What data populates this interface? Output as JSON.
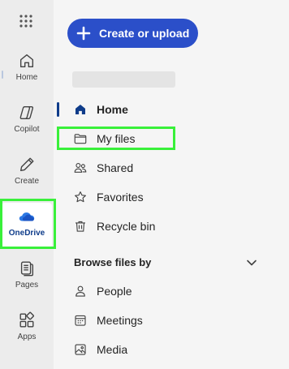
{
  "rail": {
    "items": [
      {
        "label": "Home",
        "icon": "home-icon"
      },
      {
        "label": "Copilot",
        "icon": "copilot-icon"
      },
      {
        "label": "Create",
        "icon": "pen-icon"
      },
      {
        "label": "OneDrive",
        "icon": "onedrive-cloud-icon"
      },
      {
        "label": "Pages",
        "icon": "pages-icon"
      },
      {
        "label": "Apps",
        "icon": "apps-icon"
      }
    ]
  },
  "create_button": {
    "label": "Create or upload"
  },
  "nav": {
    "items": [
      {
        "label": "Home",
        "icon": "home-icon"
      },
      {
        "label": "My files",
        "icon": "folder-icon"
      },
      {
        "label": "Shared",
        "icon": "people-icon"
      },
      {
        "label": "Favorites",
        "icon": "star-icon"
      },
      {
        "label": "Recycle bin",
        "icon": "trash-icon"
      }
    ]
  },
  "browse": {
    "heading": "Browse files by",
    "items": [
      {
        "label": "People",
        "icon": "person-icon"
      },
      {
        "label": "Meetings",
        "icon": "calendar-icon"
      },
      {
        "label": "Media",
        "icon": "image-icon"
      }
    ]
  },
  "colors": {
    "accent": "#2b4fc9",
    "highlight": "#39f03a",
    "onedrive": "#0f3c8a"
  }
}
